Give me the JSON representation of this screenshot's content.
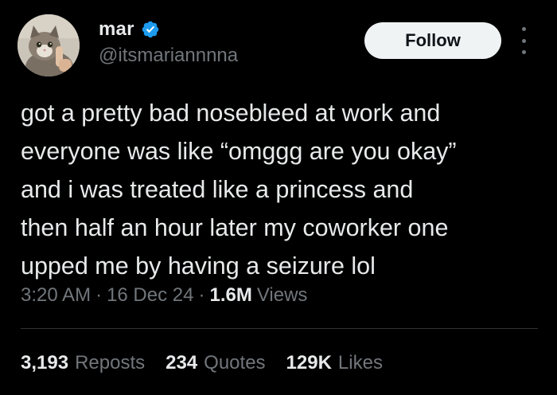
{
  "author": {
    "display_name": "mar",
    "handle": "@itsmariannnna",
    "verified_icon": "verified-badge-icon",
    "avatar_description_icon": "cat-avatar"
  },
  "actions": {
    "follow_label": "Follow",
    "more_icon": "more-vertical-icon"
  },
  "tweet": {
    "text_lines": [
      "got a pretty bad nosebleed at work and",
      "everyone was like “omggg are you okay”",
      "and i was treated like a princess and",
      "then half an hour later my coworker one",
      "upped me by having a seizure lol"
    ],
    "time": "3:20 AM",
    "date": "16 Dec 24",
    "views_count": "1.6M",
    "views_label": "Views"
  },
  "stats": {
    "reposts": {
      "count": "3,193",
      "label": "Reposts"
    },
    "quotes": {
      "count": "234",
      "label": "Quotes"
    },
    "likes": {
      "count": "129K",
      "label": "Likes"
    }
  },
  "colors": {
    "background": "#000000",
    "text_primary": "#e7e9ea",
    "text_secondary": "#71767b",
    "verified": "#1d9bf0",
    "follow_bg": "#eff3f4",
    "divider": "#2f3336"
  }
}
